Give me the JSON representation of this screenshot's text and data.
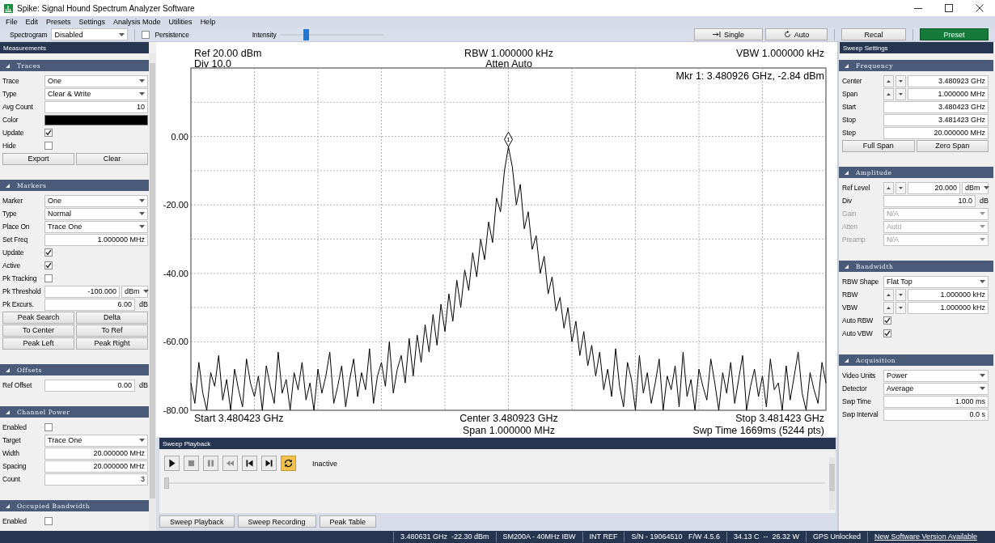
{
  "window": {
    "title": "Spike: Signal Hound Spectrum Analyzer Software"
  },
  "menu": [
    "File",
    "Edit",
    "Presets",
    "Settings",
    "Analysis Mode",
    "Utilities",
    "Help"
  ],
  "toolbar": {
    "spectrogram_label": "Spectrogram",
    "spectrogram_value": "Disabled",
    "persistence": {
      "label": "Persistence",
      "checked": false
    },
    "intensity": {
      "label": "Intensity",
      "level": 0.25
    },
    "buttons": [
      {
        "label": "Single",
        "kind": "single"
      },
      {
        "label": "Auto",
        "kind": "auto"
      },
      {
        "label": "Recal",
        "kind": "plain"
      },
      {
        "label": "Preset",
        "kind": "primary"
      }
    ]
  },
  "measurements": {
    "title": "Measurements",
    "sections": [
      {
        "title": "Traces",
        "rows": [
          {
            "kind": "select",
            "label": "Trace",
            "value": "One",
            "disabled": false
          },
          {
            "kind": "select",
            "label": "Type",
            "value": "Clear & Write",
            "disabled": false
          },
          {
            "kind": "input",
            "label": "Avg Count",
            "value": "10"
          },
          {
            "kind": "color",
            "label": "Color",
            "color": "#000000"
          },
          {
            "kind": "check",
            "label": "Update",
            "checked": true
          },
          {
            "kind": "check",
            "label": "Hide",
            "checked": false
          },
          {
            "kind": "buttons",
            "buttons": [
              "Export",
              "Clear"
            ]
          }
        ]
      },
      {
        "title": "Markers",
        "rows": [
          {
            "kind": "select",
            "label": "Marker",
            "value": "One",
            "disabled": false
          },
          {
            "kind": "select",
            "label": "Type",
            "value": "Normal",
            "disabled": false
          },
          {
            "kind": "select",
            "label": "Place On",
            "value": "Trace One",
            "disabled": false
          },
          {
            "kind": "input",
            "label": "Set Freq",
            "value": "1.000000 MHz"
          },
          {
            "kind": "check",
            "label": "Update",
            "checked": true
          },
          {
            "kind": "check",
            "label": "Active",
            "checked": true
          },
          {
            "kind": "check",
            "label": "Pk Tracking",
            "checked": false
          },
          {
            "kind": "input",
            "label": "Pk Threshold",
            "value": "-100.000",
            "unit_select": "dBm"
          },
          {
            "kind": "input",
            "label": "Pk Excurs.",
            "value": "6.00",
            "unit": "dB"
          },
          {
            "kind": "buttons",
            "buttons": [
              "Peak Search",
              "Delta"
            ]
          },
          {
            "kind": "buttons",
            "buttons": [
              "To Center",
              "To Ref"
            ]
          },
          {
            "kind": "buttons",
            "buttons": [
              "Peak Left",
              "Peak Right"
            ]
          }
        ]
      },
      {
        "title": "Offsets",
        "rows": [
          {
            "kind": "input",
            "label": "Ref Offset",
            "value": "0.00",
            "unit": "dB"
          }
        ]
      },
      {
        "title": "Channel Power",
        "rows": [
          {
            "kind": "check",
            "label": "Enabled",
            "checked": false
          },
          {
            "kind": "select",
            "label": "Target",
            "value": "Trace One",
            "disabled": false
          },
          {
            "kind": "input",
            "label": "Width",
            "value": "20.000000 MHz"
          },
          {
            "kind": "input",
            "label": "Spacing",
            "value": "20.000000 MHz"
          },
          {
            "kind": "input",
            "label": "Count",
            "value": "3"
          }
        ]
      },
      {
        "title": "Occupied Bandwidth",
        "rows": [
          {
            "kind": "check",
            "label": "Enabled",
            "checked": false
          }
        ]
      }
    ]
  },
  "chart": {
    "ref": "Ref 20.00 dBm",
    "div": "Div 10.0",
    "rbw": "RBW 1.000000 kHz",
    "atten": "Atten Auto",
    "vbw": "VBW 1.000000 kHz",
    "marker_readout": "Mkr 1: 3.480926 GHz, -2.84 dBm",
    "marker_label": "1",
    "start": "Start 3.480423 GHz",
    "center": "Center 3.480923 GHz",
    "span": "Span 1.000000 MHz",
    "stop": "Stop 3.481423 GHz",
    "sweep_time": "Swp Time 1669ms (5244 pts)",
    "chart_data": {
      "type": "line",
      "grid": true,
      "ylim": [
        -80,
        20
      ],
      "yticks": [
        {
          "value": 0,
          "label": "0.00"
        },
        {
          "value": -20,
          "label": "-20.00"
        },
        {
          "value": -40,
          "label": "-40.00"
        },
        {
          "value": -60,
          "label": "-60.00"
        },
        {
          "value": -80,
          "label": "-80.00"
        }
      ],
      "series": [
        {
          "color": "#000000",
          "values": [
            -72,
            -78,
            -66,
            -75,
            -80,
            -69,
            -73,
            -64,
            -77,
            -71,
            -80,
            -68,
            -74,
            -79,
            -65,
            -72,
            -76,
            -70,
            -80,
            -67,
            -73,
            -78,
            -63,
            -75,
            -71,
            -80,
            -69,
            -74,
            -66,
            -77,
            -72,
            -80,
            -68,
            -75,
            -70,
            -63,
            -78,
            -73,
            -67,
            -79,
            -71,
            -65,
            -76,
            -69,
            -74,
            -62,
            -78,
            -70,
            -66,
            -73,
            -60,
            -75,
            -68,
            -64,
            -72,
            -59,
            -70,
            -58,
            -66,
            -55,
            -63,
            -52,
            -61,
            -49,
            -57,
            -46,
            -54,
            -42,
            -50,
            -39,
            -45,
            -34,
            -41,
            -30,
            -36,
            -25,
            -31,
            -18,
            -22,
            -10,
            -3,
            -9,
            -20,
            -14,
            -27,
            -22,
            -33,
            -29,
            -40,
            -35,
            -46,
            -41,
            -51,
            -47,
            -56,
            -50,
            -60,
            -54,
            -64,
            -57,
            -67,
            -61,
            -70,
            -63,
            -74,
            -68,
            -76,
            -62,
            -73,
            -79,
            -66,
            -71,
            -80,
            -64,
            -75,
            -69,
            -78,
            -72,
            -65,
            -80,
            -70,
            -74,
            -67,
            -79,
            -63,
            -76,
            -71,
            -80,
            -68,
            -73,
            -77,
            -65,
            -72,
            -80,
            -69,
            -75,
            -66,
            -78,
            -71,
            -64,
            -80,
            -73,
            -68,
            -76,
            -70,
            -79,
            -65,
            -74,
            -72,
            -80,
            -67,
            -77,
            -70,
            -63,
            -75,
            -80,
            -69,
            -74,
            -78,
            -66,
            -72
          ]
        }
      ]
    }
  },
  "sweep_playback": {
    "title": "Sweep Playback",
    "controls": [
      {
        "kind": "play",
        "disabled": false,
        "on": false
      },
      {
        "kind": "stop",
        "disabled": true,
        "on": false
      },
      {
        "kind": "pause",
        "disabled": true,
        "on": false
      },
      {
        "kind": "rewind",
        "disabled": true,
        "on": false
      },
      {
        "kind": "skip_back",
        "disabled": false,
        "on": false
      },
      {
        "kind": "skip_forward",
        "disabled": false,
        "on": false
      },
      {
        "kind": "loop",
        "disabled": false,
        "on": true
      }
    ],
    "status": "Inactive",
    "position": {
      "level": 0
    }
  },
  "bottom_buttons": [
    "Sweep Playback",
    "Sweep Recording",
    "Peak Table"
  ],
  "sweep_settings": {
    "title": "Sweep Settings",
    "sections": [
      {
        "title": "Frequency",
        "rows": [
          {
            "kind": "spin",
            "label": "Center",
            "value": "3.480923 GHz"
          },
          {
            "kind": "spin",
            "label": "Span",
            "value": "1.000000 MHz"
          },
          {
            "kind": "input",
            "label": "Start",
            "value": "3.480423 GHz"
          },
          {
            "kind": "input",
            "label": "Stop",
            "value": "3.481423 GHz"
          },
          {
            "kind": "input",
            "label": "Step",
            "value": "20.000000 MHz"
          },
          {
            "kind": "buttons",
            "buttons": [
              "Full Span",
              "Zero Span"
            ]
          }
        ]
      },
      {
        "title": "Amplitude",
        "rows": [
          {
            "kind": "spin",
            "label": "Ref Level",
            "value": "20.000",
            "unit_select": "dBm"
          },
          {
            "kind": "input",
            "label": "Div",
            "value": "10.0",
            "unit": "dB"
          },
          {
            "kind": "select",
            "label": "Gain",
            "value": "N/A",
            "disabled": true
          },
          {
            "kind": "select",
            "label": "Atten",
            "value": "Auto",
            "disabled": true
          },
          {
            "kind": "select",
            "label": "Preamp",
            "value": "N/A",
            "disabled": true
          }
        ]
      },
      {
        "title": "Bandwidth",
        "rows": [
          {
            "kind": "select",
            "label": "RBW Shape",
            "value": "Flat Top",
            "disabled": false
          },
          {
            "kind": "spin",
            "label": "RBW",
            "value": "1.000000 kHz"
          },
          {
            "kind": "spin",
            "label": "VBW",
            "value": "1.000000 kHz"
          },
          {
            "kind": "check",
            "label": "Auto RBW",
            "checked": true
          },
          {
            "kind": "check",
            "label": "Auto VBW",
            "checked": true
          }
        ]
      },
      {
        "title": "Acquisition",
        "rows": [
          {
            "kind": "select",
            "label": "Video Units",
            "value": "Power",
            "disabled": false
          },
          {
            "kind": "select",
            "label": "Detector",
            "value": "Average",
            "disabled": false
          },
          {
            "kind": "input",
            "label": "Swp Time",
            "value": "1.000 ms"
          },
          {
            "kind": "input",
            "label": "Swp Interval",
            "value": "0.0 s"
          }
        ]
      }
    ]
  },
  "status_bar": [
    {
      "kind": "text",
      "text": "3.480631 GHz  -22.30 dBm"
    },
    {
      "kind": "text",
      "text": "SM200A - 40MHz IBW"
    },
    {
      "kind": "text",
      "text": "INT REF"
    },
    {
      "kind": "text",
      "text": "S/N - 19064510   F/W 4.5.6"
    },
    {
      "kind": "text",
      "text": "34.13 C  --  26.32 W"
    },
    {
      "kind": "text",
      "text": "GPS Unlocked"
    },
    {
      "kind": "link",
      "text": "New Software Version Available"
    }
  ]
}
